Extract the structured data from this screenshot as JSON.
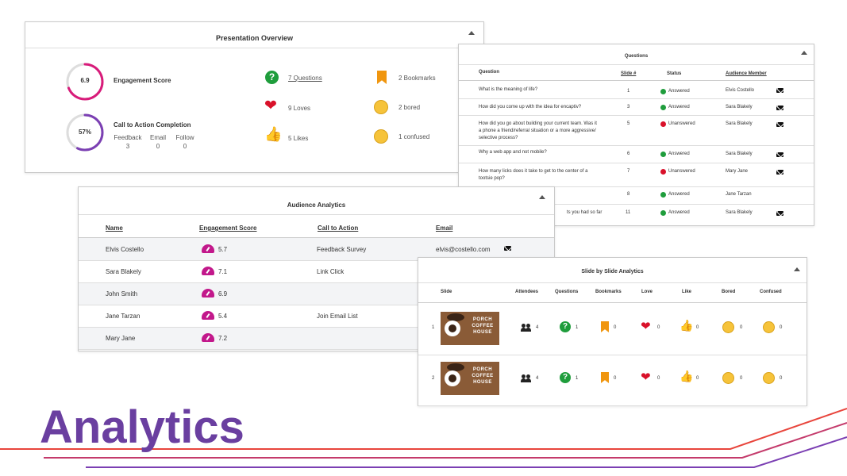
{
  "overview": {
    "title": "Presentation Overview",
    "engagement": {
      "value": "6.9",
      "label": "Engagement Score",
      "fraction": 0.69
    },
    "cta": {
      "value": "57%",
      "label": "Call to Action Completion",
      "fraction": 0.57,
      "columns": [
        {
          "label": "Feedback",
          "value": "3"
        },
        {
          "label": "Email",
          "value": "0"
        },
        {
          "label": "Follow",
          "value": "0"
        }
      ]
    },
    "stats": {
      "questions": "7 Questions",
      "loves": "9 Loves",
      "likes": "5 Likes",
      "bookmarks": "2 Bookmarks",
      "bored": "2 bored",
      "confused": "1 confused"
    }
  },
  "questions": {
    "title": "Questions",
    "headers": {
      "question": "Question",
      "slide": "Slide #",
      "status": "Status",
      "member": "Audience Member"
    },
    "rows": [
      {
        "question": "What is the meaning of life?",
        "question2": "",
        "slide": "1",
        "status": "Answered",
        "member": "Elvis Costello",
        "mail": true
      },
      {
        "question": "How did you come up with the idea for encaptiv?",
        "question2": "",
        "slide": "3",
        "status": "Answered",
        "member": "Sara Blakely",
        "mail": true
      },
      {
        "question": "How did you go about building your current team. Was it",
        "question2": "a phone a friend/referral situation or a more aggressive/",
        "question3": "selective process?",
        "slide": "5",
        "status": "Unanswered",
        "member": "Sara Blakely",
        "mail": true
      },
      {
        "question": "Why a web app and not mobile?",
        "question2": "",
        "slide": "6",
        "status": "Answered",
        "member": "Sara Blakely",
        "mail": true
      },
      {
        "question": "How many licks does it take to get to the center of a",
        "question2": "tootsie pop?",
        "slide": "7",
        "status": "Unanswered",
        "member": "Mary Jane",
        "mail": true
      },
      {
        "question": "",
        "question2": "",
        "slide": "8",
        "status": "Answered",
        "member": "Jane Tarzan",
        "mail": false
      },
      {
        "question": "ts you had so far",
        "question2": "",
        "slide": "11",
        "status": "Answered",
        "member": "Sara Blakely",
        "mail": true
      }
    ],
    "colors": {
      "answered": "#1f9d3c",
      "unanswered": "#d9112a"
    }
  },
  "audience": {
    "title": "Audience Analytics",
    "headers": {
      "name": "Name",
      "score": "Engagement Score",
      "cta": "Call to Action",
      "email": "Email"
    },
    "rows": [
      {
        "name": "Elvis Costello",
        "score": "5.7",
        "cta": "Feedback Survey",
        "email": "elvis@costello.com"
      },
      {
        "name": "Sara Blakely",
        "score": "7.1",
        "cta": "Link Click",
        "email": ""
      },
      {
        "name": "John Smith",
        "score": "6.9",
        "cta": "",
        "email": ""
      },
      {
        "name": "Jane Tarzan",
        "score": "5.4",
        "cta": "Join Email List",
        "email": ""
      },
      {
        "name": "Mary Jane",
        "score": "7.2",
        "cta": "",
        "email": ""
      }
    ]
  },
  "slides": {
    "title": "Slide by Slide Analytics",
    "headers": {
      "slide": "Slide",
      "attendees": "Attendees",
      "questions": "Questions",
      "bookmarks": "Bookmarks",
      "love": "Love",
      "like": "Like",
      "bored": "Bored",
      "confused": "Confused"
    },
    "rows": [
      {
        "num": "1",
        "thumb_text": "PORCH COFFEE HOUSE",
        "attendees": "4",
        "questions": "1",
        "bookmarks": "0",
        "love": "0",
        "like": "0",
        "bored": "0",
        "confused": "0"
      },
      {
        "num": "2",
        "thumb_text": "PORCH COFFEE HOUSE",
        "attendees": "4",
        "questions": "1",
        "bookmarks": "0",
        "love": "0",
        "like": "0",
        "bored": "0",
        "confused": "0"
      }
    ]
  },
  "footer": {
    "heading": "Analytics"
  },
  "colors": {
    "brand_purple": "#6a3fa0",
    "accent_red": "#e8453c",
    "ring_pink": "#d81b7a",
    "ring_purple": "#7b3fb3"
  }
}
